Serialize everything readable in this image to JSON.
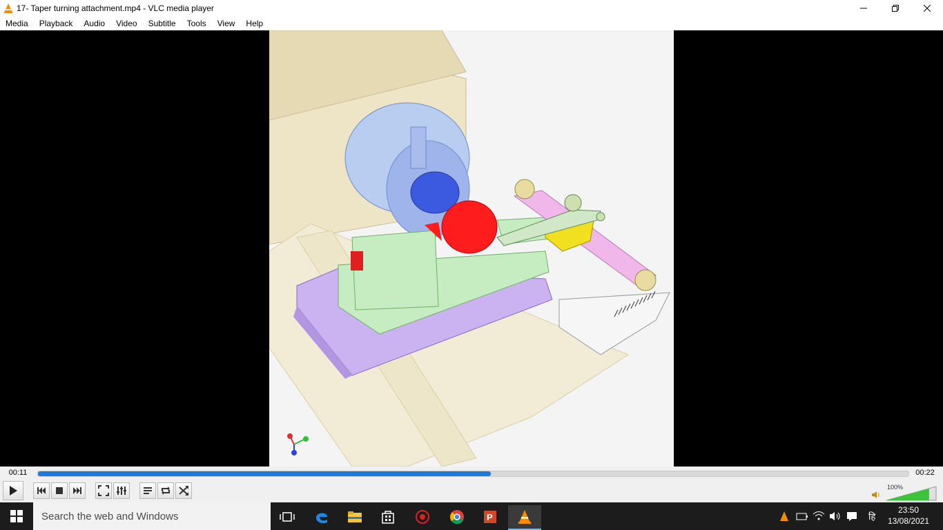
{
  "window": {
    "title": "17- Taper turning attachment.mp4 - VLC media player",
    "controls": {
      "minimize": "—",
      "maximize": "❐",
      "close": "✕"
    }
  },
  "menu": [
    "Media",
    "Playback",
    "Audio",
    "Video",
    "Subtitle",
    "Tools",
    "View",
    "Help"
  ],
  "player": {
    "current_time": "00:11",
    "total_time": "00:22",
    "progress": 0.52,
    "volume_label": "100%",
    "volume": 1.0
  },
  "taskbar": {
    "search_placeholder": "Search the web and Windows",
    "time": "23:50",
    "date": "13/08/2021",
    "lang": "हि"
  },
  "colors": {
    "accent": "#1e7bd9",
    "taskbar": "#1c1c1c",
    "volume_green": "#3cc43c"
  }
}
